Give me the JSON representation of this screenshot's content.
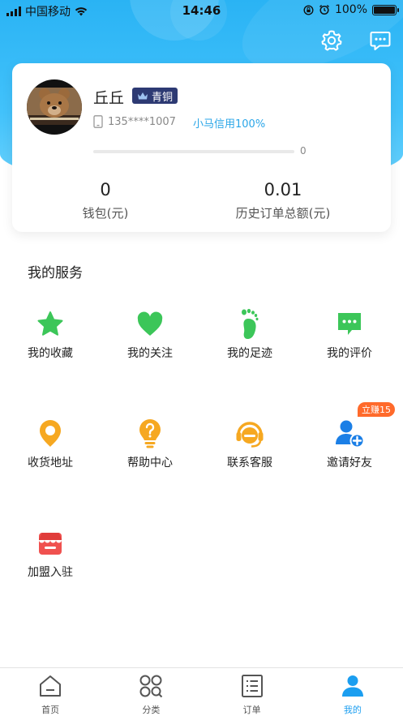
{
  "status_bar": {
    "carrier": "中国移动",
    "time": "14:46",
    "battery": "100%"
  },
  "header": {
    "settings_icon": "gear-icon",
    "message_icon": "chat-icon"
  },
  "profile": {
    "name": "丘丘",
    "level_badge": "青铜",
    "phone": "135****1007",
    "credit": "小马信用100%",
    "progress_value": "0",
    "progress_fraction": 0,
    "wallet_value": "0",
    "wallet_label": "钱包(元)",
    "history_value": "0.01",
    "history_label": "历史订单总额(元)"
  },
  "services": {
    "title": "我的服务",
    "items": [
      {
        "label": "我的收藏",
        "icon": "star-icon"
      },
      {
        "label": "我的关注",
        "icon": "heart-icon"
      },
      {
        "label": "我的足迹",
        "icon": "footprint-icon"
      },
      {
        "label": "我的评价",
        "icon": "comment-icon"
      },
      {
        "label": "收货地址",
        "icon": "location-icon"
      },
      {
        "label": "帮助中心",
        "icon": "help-bulb-icon"
      },
      {
        "label": "联系客服",
        "icon": "headset-icon"
      },
      {
        "label": "邀请好友",
        "icon": "add-friend-icon"
      },
      {
        "label": "加盟入驻",
        "icon": "store-icon"
      }
    ],
    "invite_tag": "立赚15"
  },
  "tabbar": {
    "tabs": [
      {
        "label": "首页",
        "icon": "home-icon"
      },
      {
        "label": "分类",
        "icon": "category-icon"
      },
      {
        "label": "订单",
        "icon": "order-list-icon"
      },
      {
        "label": "我的",
        "icon": "user-icon"
      }
    ],
    "active_index": 3
  },
  "colors": {
    "primary_blue": "#2ab3f4",
    "green": "#3cc659",
    "orange": "#f6a821",
    "blue_icon": "#1b7fe6",
    "red": "#f0514f",
    "badge_navy": "#2d3a73",
    "tag_orange": "#ff6a2b"
  }
}
